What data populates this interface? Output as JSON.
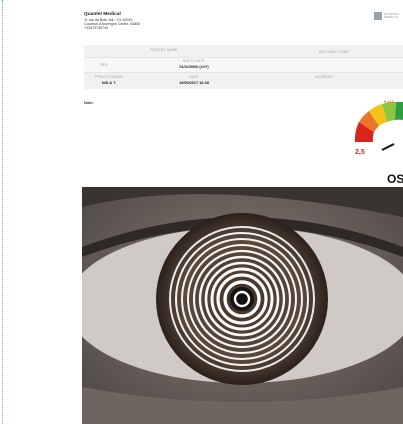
{
  "clinic": {
    "name": "Quantel Medical",
    "address_lines": [
      "11 rue du Bois Joli - CS 40015",
      "Cournon d'Auvergne Cedex, 63800",
      "+33473745745"
    ]
  },
  "logo": {
    "text_lines": [
      "QUANTEL",
      "MEDICAL"
    ]
  },
  "patient_table": {
    "patient_name_label": "PATIENT NAME",
    "delivery_code_label": "DELIVERY CODE",
    "sex_label": "SEX",
    "birth_date_label": "BIRTH DATE",
    "birth_date_value": "01/01/0000 (##Y)",
    "address_label": "ADDRESS",
    "practitioner_label": "PRACTITIONER",
    "practitioner_value": "N/D & T.",
    "date_label": "DATE",
    "date_value": "19/09/2017 16:28"
  },
  "note_label": "Note:",
  "gauge": {
    "value_text": "2,5",
    "value": 2.5,
    "top_right_text": "ft 4/10",
    "colors": [
      "#d9261c",
      "#e8752a",
      "#f2c318",
      "#8cc63f",
      "#2e9e3e"
    ]
  },
  "eye_label": "OS",
  "colors": {
    "iris": "#5b4a3a",
    "sclera": "#d9d6d2",
    "skin": "#8f8580",
    "ring_light": "#f4f4f4",
    "ring_dark": "#2a2622"
  }
}
